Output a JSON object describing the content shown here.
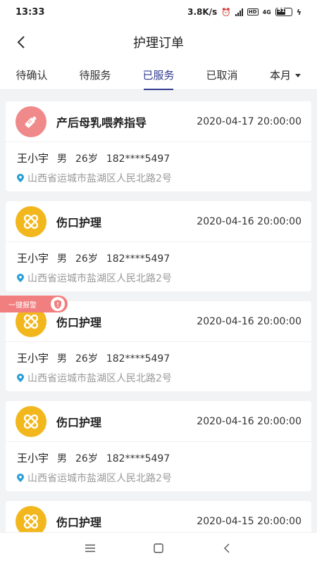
{
  "status_bar": {
    "time": "13:33",
    "speed": "3.8K/s",
    "network": "4G",
    "battery": "51"
  },
  "header": {
    "title": "护理订单"
  },
  "tabs": [
    {
      "label": "待确认"
    },
    {
      "label": "待服务"
    },
    {
      "label": "已服务"
    },
    {
      "label": "已取消"
    }
  ],
  "active_tab": "已服务",
  "filter": {
    "label": "本月"
  },
  "sos": {
    "label": "一键报警"
  },
  "orders": [
    {
      "service": "产后母乳喂养指导",
      "time": "2020-04-17 20:00:00",
      "icon": "baby-bottle-icon",
      "icon_color": "#f08a8a",
      "name": "王小宇",
      "gender": "男",
      "age": "26岁",
      "phone": "182****5497",
      "address": "山西省运城市盐湖区人民北路2号"
    },
    {
      "service": "伤口护理",
      "time": "2020-04-16 20:00:00",
      "icon": "bandage-icon",
      "icon_color": "#f2b71c",
      "name": "王小宇",
      "gender": "男",
      "age": "26岁",
      "phone": "182****5497",
      "address": "山西省运城市盐湖区人民北路2号"
    },
    {
      "service": "伤口护理",
      "time": "2020-04-16 20:00:00",
      "icon": "bandage-icon",
      "icon_color": "#f2b71c",
      "name": "王小宇",
      "gender": "男",
      "age": "26岁",
      "phone": "182****5497",
      "address": "山西省运城市盐湖区人民北路2号"
    },
    {
      "service": "伤口护理",
      "time": "2020-04-16 20:00:00",
      "icon": "bandage-icon",
      "icon_color": "#f2b71c",
      "name": "王小宇",
      "gender": "男",
      "age": "26岁",
      "phone": "182****5497",
      "address": "山西省运城市盐湖区人民北路2号"
    },
    {
      "service": "伤口护理",
      "time": "2020-04-15 20:00:00",
      "icon": "bandage-icon",
      "icon_color": "#f2b71c"
    }
  ],
  "colors": {
    "accent": "#2f3a8f",
    "pin": "#2a9fd6",
    "sos": "#f27f7f"
  }
}
